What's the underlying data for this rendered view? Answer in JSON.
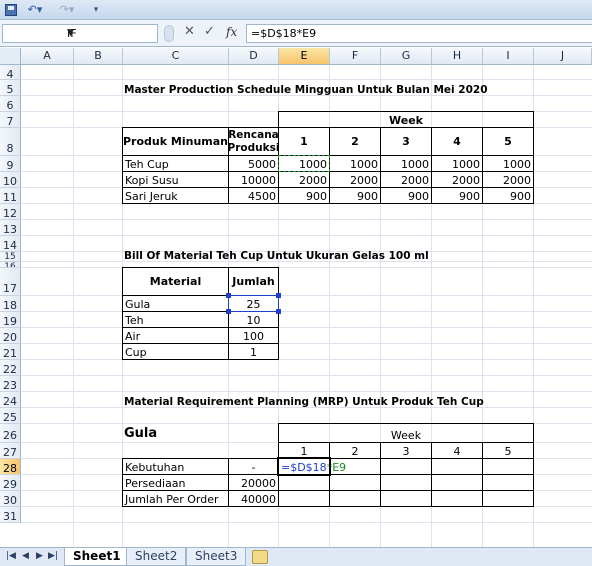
{
  "toolbar": {
    "save_icon": "save-icon",
    "undo_glyph": "↶▾",
    "redo_glyph": "↷▾",
    "customize_glyph": "▾"
  },
  "formula_bar": {
    "name_box": "IF",
    "name_dropdown": "▼",
    "cancel_glyph": "✕",
    "enter_glyph": "✓",
    "fx_label": "fx",
    "formula": "=$D$18*E9"
  },
  "columns": [
    "A",
    "B",
    "C",
    "D",
    "E",
    "F",
    "G",
    "H",
    "I",
    "J"
  ],
  "rows": [
    "4",
    "5",
    "6",
    "7",
    "8",
    "9",
    "10",
    "11",
    "12",
    "13",
    "14",
    "15",
    "16",
    "17",
    "18",
    "19",
    "20",
    "21",
    "22",
    "23",
    "24",
    "25",
    "26",
    "27",
    "28",
    "29",
    "30",
    "31"
  ],
  "mps": {
    "title": "Master Production Schedule Mingguan Untuk Bulan Mei 2020",
    "week_label": "Week",
    "product_header": "Produk Minuman",
    "plan_header_1": "Rencana",
    "plan_header_2": "Produksi",
    "weeks": [
      "1",
      "2",
      "3",
      "4",
      "5"
    ],
    "rows": [
      {
        "product": "Teh Cup",
        "plan": "5000",
        "values": [
          "1000",
          "1000",
          "1000",
          "1000",
          "1000"
        ]
      },
      {
        "product": "Kopi Susu",
        "plan": "10000",
        "values": [
          "2000",
          "2000",
          "2000",
          "2000",
          "2000"
        ]
      },
      {
        "product": "Sari Jeruk",
        "plan": "4500",
        "values": [
          "900",
          "900",
          "900",
          "900",
          "900"
        ]
      }
    ]
  },
  "bom": {
    "title": "Bill Of Material Teh Cup Untuk Ukuran Gelas 100 ml",
    "material_header": "Material",
    "qty_header": "Jumlah",
    "rows": [
      {
        "material": "Gula",
        "qty": "25"
      },
      {
        "material": "Teh",
        "qty": "10"
      },
      {
        "material": "Air",
        "qty": "100"
      },
      {
        "material": "Cup",
        "qty": "1"
      }
    ]
  },
  "mrp": {
    "title": "Material Requirement Planning (MRP) Untuk Produk Teh Cup",
    "item": "Gula",
    "week_label": "Week",
    "weeks": [
      "1",
      "2",
      "3",
      "4",
      "5"
    ],
    "rows": [
      {
        "label": "Kebutuhan",
        "value": "-"
      },
      {
        "label": "Persediaan",
        "value": "20000"
      },
      {
        "label": "Jumlah Per Order",
        "value": "40000"
      }
    ],
    "editing_prefix": "=$D$18",
    "editing_suffix": "*E9"
  },
  "sheet_tabs": [
    "Sheet1",
    "Sheet2",
    "Sheet3"
  ],
  "tab_nav": [
    "|◀",
    "◀",
    "▶",
    "▶|"
  ],
  "colors": {
    "selection_header": "#f7c46b",
    "reference_blue": "#1f3fd0",
    "copy_marquee_green": "#1b8a2a"
  }
}
